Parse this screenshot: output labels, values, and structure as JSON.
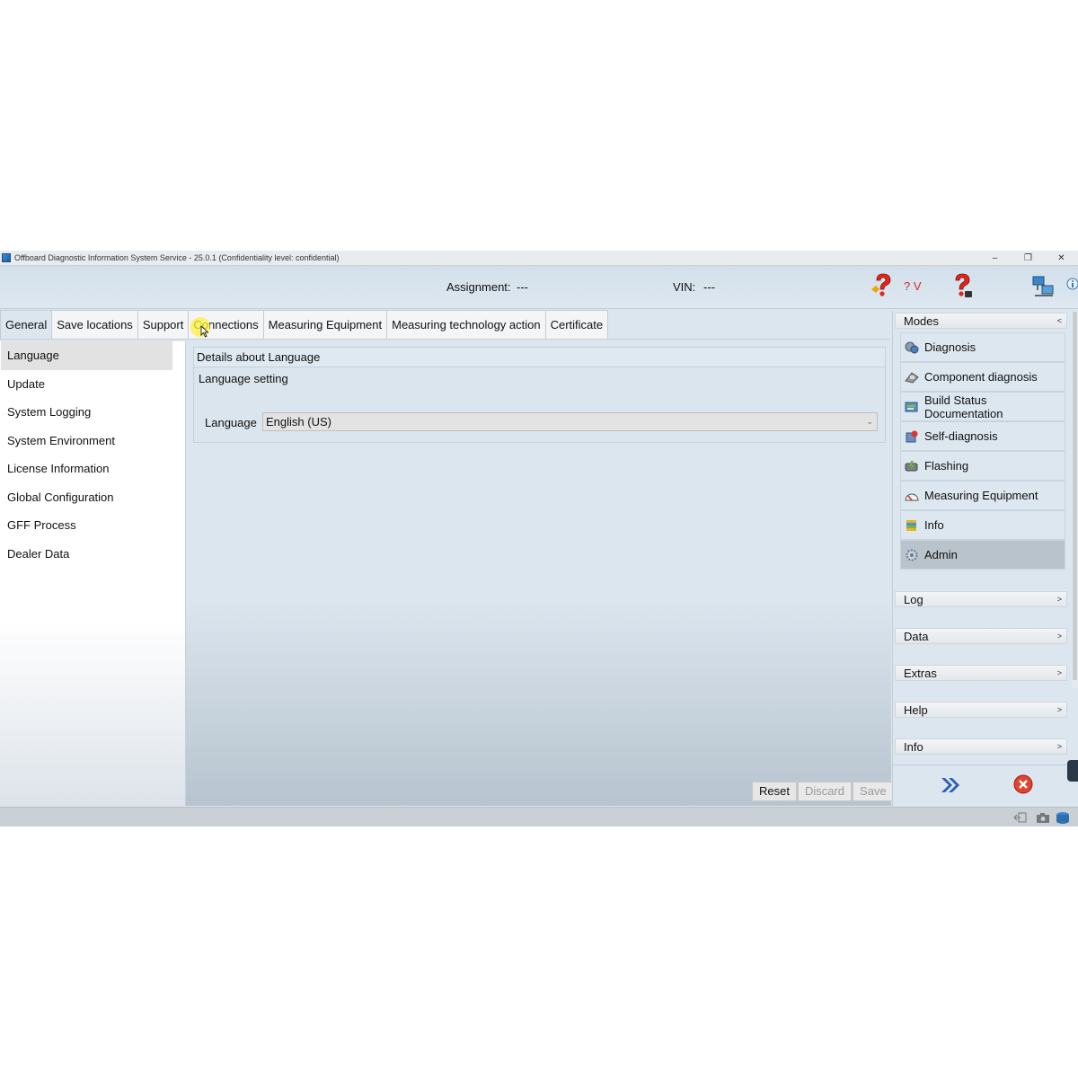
{
  "window": {
    "title": "Offboard Diagnostic Information System Service - 25.0.1 (Confidentiality level: confidential)",
    "controls": [
      "–",
      "❐",
      "✕"
    ]
  },
  "header": {
    "assignment_label": "Assignment:",
    "assignment_value": "---",
    "vin_label": "VIN:",
    "vin_value": "---",
    "help_version_text": "? V",
    "icons": [
      "help-red-icon",
      "help-question-icon",
      "network-icon",
      "info-icon"
    ]
  },
  "tabs": [
    {
      "label": "General",
      "active": true
    },
    {
      "label": "Save locations",
      "active": false
    },
    {
      "label": "Support",
      "active": false
    },
    {
      "label": "Connections",
      "active": false
    },
    {
      "label": "Measuring Equipment",
      "active": false
    },
    {
      "label": "Measuring technology action",
      "active": false
    },
    {
      "label": "Certificate",
      "active": false
    }
  ],
  "left_nav": [
    {
      "label": "Language",
      "selected": true
    },
    {
      "label": "Update",
      "selected": false
    },
    {
      "label": "System Logging",
      "selected": false
    },
    {
      "label": "System Environment",
      "selected": false
    },
    {
      "label": "License Information",
      "selected": false
    },
    {
      "label": "Global Configuration",
      "selected": false
    },
    {
      "label": "GFF Process",
      "selected": false
    },
    {
      "label": "Dealer Data",
      "selected": false
    }
  ],
  "details": {
    "title": "Details about Language",
    "setting_label": "Language setting",
    "language_label": "Language",
    "language_value": "English (US)"
  },
  "buttons": {
    "reset": "Reset",
    "discard": "Discard",
    "save": "Save"
  },
  "right_panel": {
    "modes_title": "Modes",
    "modes": [
      {
        "label": "Diagnosis",
        "icon": "diagnosis-icon",
        "active": false
      },
      {
        "label": "Component diagnosis",
        "icon": "component-icon",
        "active": false
      },
      {
        "label": "Build Status Documentation",
        "icon": "build-status-icon",
        "active": false
      },
      {
        "label": "Self-diagnosis",
        "icon": "self-diagnosis-icon",
        "active": false
      },
      {
        "label": "Flashing",
        "icon": "flashing-icon",
        "active": false
      },
      {
        "label": "Measuring Equipment",
        "icon": "gauge-icon",
        "active": false
      },
      {
        "label": "Info",
        "icon": "books-icon",
        "active": false
      },
      {
        "label": "Admin",
        "icon": "admin-gear-icon",
        "active": true
      }
    ],
    "sections": [
      "Log",
      "Data",
      "Extras",
      "Help",
      "Info"
    ]
  },
  "colors": {
    "background": "#dbe6ef",
    "active_mode": "#b9c3cc",
    "help_red": "#d9261c"
  }
}
